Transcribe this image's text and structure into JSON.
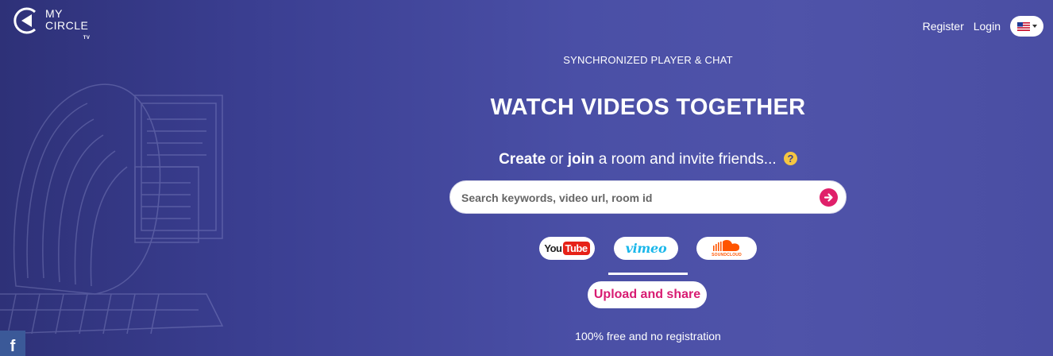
{
  "logo": {
    "line1": "MY",
    "line2": "CIRCLE",
    "line3": "TV"
  },
  "nav": {
    "register": "Register",
    "login": "Login",
    "language_icon": "us-flag-icon"
  },
  "hero": {
    "subtitle": "SYNCHRONIZED PLAYER & CHAT",
    "title": "WATCH VIDEOS TOGETHER",
    "tagline_create": "Create",
    "tagline_or": " or ",
    "tagline_join": "join",
    "tagline_rest": " a room and invite friends...",
    "help_symbol": "?"
  },
  "search": {
    "placeholder": "Search keywords, video url, room id",
    "value": ""
  },
  "providers": {
    "youtube_a": "You",
    "youtube_b": "Tube",
    "vimeo": "vimeo",
    "soundcloud": "SOUNDCLOUD"
  },
  "upload": {
    "label": "Upload and share"
  },
  "footer": {
    "note": "100% free and no registration"
  },
  "social": {
    "facebook": "f"
  },
  "colors": {
    "accent": "#e0206a",
    "upload_text": "#d81b72",
    "background": "#4a4fa6",
    "help": "#f5c542"
  }
}
